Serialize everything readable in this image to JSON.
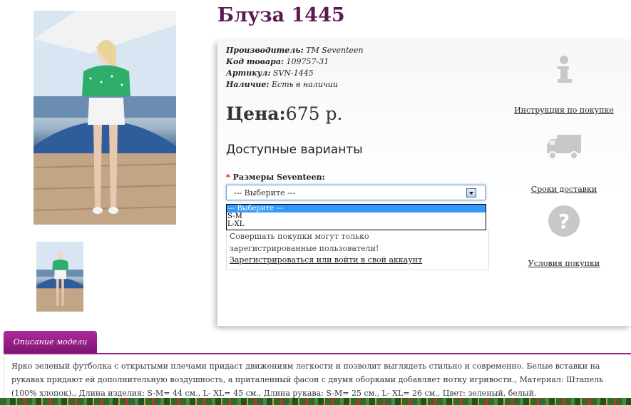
{
  "product": {
    "title": "Блуза 1445"
  },
  "info": {
    "manufacturer_label": "Производитель:",
    "manufacturer_value": "TM Seventeen",
    "code_label": "Код товара:",
    "code_value": "109757-31",
    "sku_label": "Артикул:",
    "sku_value": "SVN-1445",
    "availability_label": "Наличие:",
    "availability_value": "Есть в наличии"
  },
  "price": {
    "label": "Цена:",
    "value": "675 р."
  },
  "variants_heading": "Доступные варианты",
  "sizes": {
    "required_mark": "*",
    "label": "Размеры Seventeen:",
    "selected": "--- Выберите ---",
    "options": [
      "--- Выберите ---",
      "S-M",
      "L-XL"
    ]
  },
  "registration": {
    "message": "Совершать покупки могут только зарегистрированные пользователи!",
    "link": "Зарегистрироваться или войти в свой аккаунт"
  },
  "side_links": {
    "instruction": "Инструкция по покупке",
    "delivery": "Сроки доставки",
    "conditions": "Условия покупки"
  },
  "tab": {
    "label": "Описание модели"
  },
  "description": "Ярко зеленый футболка с открытыми плечами придаст движениям легкости и позволит выглядеть стильно и современно. Белые вставки на рукавах придают ей дополнительную воздушность, а приталенный фасон с двумя оборками добавляет нотку игривости., Материал: Штапель (100% хлопок)., Длина изделия: S-M= 44 см., L- XL= 45 см., Длина рукава: S-M= 25 см., L- XL= 26 см., Цвет: зеленый, белый."
}
